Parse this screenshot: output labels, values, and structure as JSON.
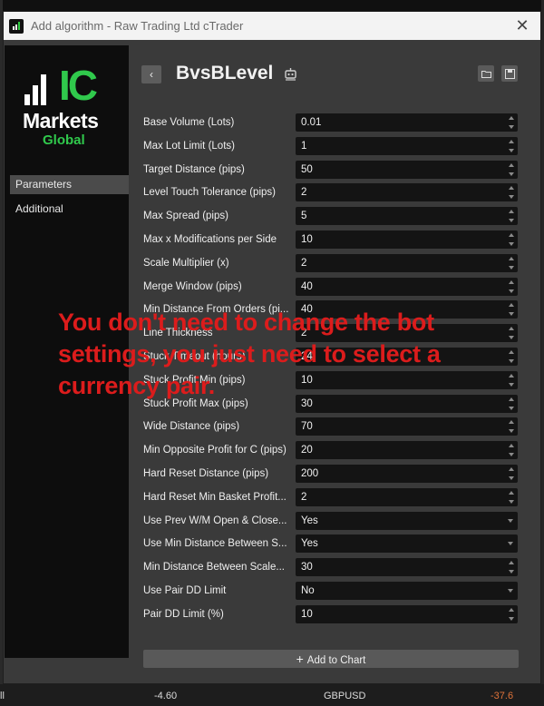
{
  "window": {
    "title": "Add algorithm - Raw Trading Ltd cTrader",
    "close_glyph": "✕"
  },
  "sidebar": {
    "logo": {
      "ic": "IC",
      "markets": "Markets",
      "global": "Global",
      "brand_green": "#30c94c"
    },
    "items": [
      {
        "label": "Parameters",
        "active": true
      },
      {
        "label": "Additional",
        "active": false
      }
    ]
  },
  "header": {
    "back_glyph": "‹",
    "title": "BvsBLevel",
    "algo_icon": "robot-icon",
    "tools": [
      "folder-icon",
      "save-icon"
    ]
  },
  "parameters": [
    {
      "label": "Base Volume (Lots)",
      "value": "0.01",
      "kind": "number"
    },
    {
      "label": "Max Lot Limit (Lots)",
      "value": "1",
      "kind": "number"
    },
    {
      "label": "Target Distance (pips)",
      "value": "50",
      "kind": "number"
    },
    {
      "label": "Level Touch Tolerance (pips)",
      "value": "2",
      "kind": "number"
    },
    {
      "label": "Max Spread (pips)",
      "value": "5",
      "kind": "number"
    },
    {
      "label": "Max x Modifications per Side",
      "value": "10",
      "kind": "number"
    },
    {
      "label": "Scale Multiplier (x)",
      "value": "2",
      "kind": "number"
    },
    {
      "label": "Merge Window (pips)",
      "value": "40",
      "kind": "number"
    },
    {
      "label": "Min Distance From Orders (pi...",
      "value": "40",
      "kind": "number"
    },
    {
      "label": "Line Thickness",
      "value": "2",
      "kind": "number"
    },
    {
      "label": "Stuck Timeout (hours)",
      "value": "24",
      "kind": "number"
    },
    {
      "label": "Stuck Profit Min (pips)",
      "value": "10",
      "kind": "number"
    },
    {
      "label": "Stuck Profit Max (pips)",
      "value": "30",
      "kind": "number"
    },
    {
      "label": "Wide Distance (pips)",
      "value": "70",
      "kind": "number"
    },
    {
      "label": "Min Opposite Profit for C (pips)",
      "value": "20",
      "kind": "number"
    },
    {
      "label": "Hard Reset Distance (pips)",
      "value": "200",
      "kind": "number"
    },
    {
      "label": "Hard Reset Min Basket Profit...",
      "value": "2",
      "kind": "number"
    },
    {
      "label": "Use Prev W/M Open & Close...",
      "value": "Yes",
      "kind": "select"
    },
    {
      "label": "Use Min Distance Between S...",
      "value": "Yes",
      "kind": "select"
    },
    {
      "label": "Min Distance Between Scale...",
      "value": "30",
      "kind": "number"
    },
    {
      "label": "Use Pair DD Limit",
      "value": "No",
      "kind": "select"
    },
    {
      "label": "Pair DD Limit (%)",
      "value": "10",
      "kind": "number"
    }
  ],
  "footer": {
    "add_to_chart": "Add to Chart"
  },
  "overlay_note": "You don't need to change the bot settings, you just need to select a currency pair.",
  "status_bar": {
    "left": "ll",
    "value1": "-4.60",
    "symbol": "GBPUSD",
    "value2": "-37.6"
  },
  "colors": {
    "overlay_red": "#dc1c1c",
    "negative_orange": "#e0733a"
  }
}
